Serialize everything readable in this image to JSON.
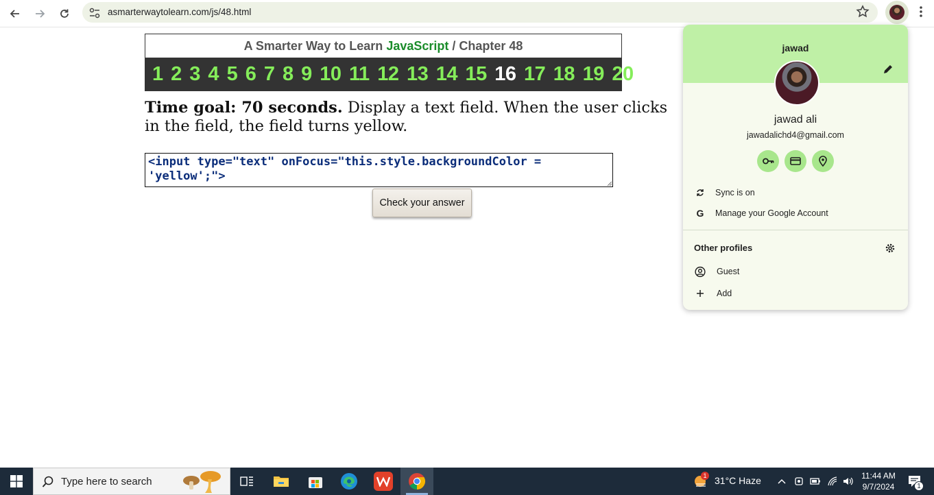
{
  "browser": {
    "url": "asmarterwaytolearn.com/js/48.html"
  },
  "header": {
    "title_prefix": "A Smarter Way to Learn ",
    "title_js": "JavaScript",
    "title_suffix": "  /  Chapter 48",
    "chapters": [
      "1",
      "2",
      "3",
      "4",
      "5",
      "6",
      "7",
      "8",
      "9",
      "10",
      "11",
      "12",
      "13",
      "14",
      "15",
      "16",
      "17",
      "18",
      "19",
      "20"
    ],
    "current_chapter": "16"
  },
  "exercise": {
    "goal": "Time goal: 70 seconds.",
    "instruction": " Display a text field. When the user clicks in the field, the field turns yellow.",
    "answer": "<input type=\"text\" onFocus=\"this.style.backgroundColor = 'yellow';\">",
    "check_label": "Check your answer"
  },
  "profile": {
    "short_name": "jawad",
    "full_name": "jawad ali",
    "email": "jawadalichd4@gmail.com",
    "quick_actions": [
      "key-icon",
      "credit-card-icon",
      "location-pin-icon"
    ],
    "sync_label": "Sync is on",
    "manage_label": "Manage your Google Account",
    "other_profiles_title": "Other profiles",
    "guest_label": "Guest",
    "add_label": "Add",
    "accent_color": "#bff0a6"
  },
  "taskbar": {
    "search_placeholder": "Type here to search",
    "weather": "31°C  Haze",
    "weather_badge": "1",
    "time": "11:44 AM",
    "date": "9/7/2024",
    "notification_count": "1"
  }
}
